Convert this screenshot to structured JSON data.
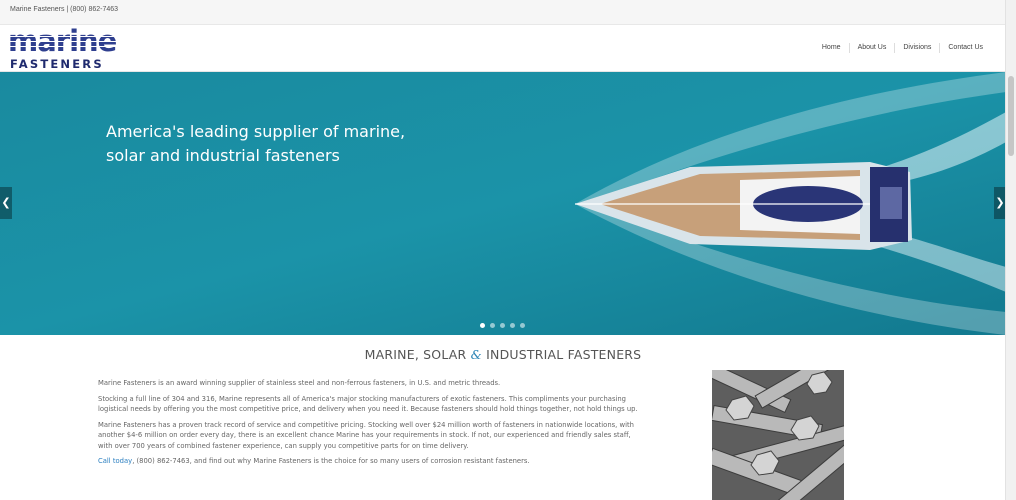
{
  "topbar": {
    "text": "Marine Fasteners | (800) 862-7463"
  },
  "logo": {
    "top": "marine",
    "bottom": "FASTENERS"
  },
  "nav": {
    "items": [
      "Home",
      "About Us",
      "Divisions",
      "Contact Us"
    ]
  },
  "hero": {
    "headline": "America's leading supplier of marine, solar and industrial fasteners",
    "slides": {
      "count": 5,
      "active": 1
    }
  },
  "section": {
    "title_part1": "MARINE, SOLAR",
    "title_amp": "&",
    "title_part2": "INDUSTRIAL FASTENERS"
  },
  "content": {
    "p1": "Marine Fasteners is an award winning supplier of stainless steel and non-ferrous fasteners, in U.S. and metric threads.",
    "p2": "Stocking a full line of 304 and 316, Marine represents all of America's major stocking manufacturers of exotic fasteners. This compliments your purchasing logistical needs by offering you the most competitive price, and delivery when you need it. Because fasteners should hold things together, not hold things up.",
    "p3": "Marine Fasteners has a proven track record of service and competitive pricing. Stocking well over $24 million worth of fasteners in nationwide locations, with another $4-6 million on order every day, there is an excellent chance Marine has your requirements in stock. If not, our experienced and friendly sales staff, with over 700 years of combined fastener experience, can supply you competitive parts for on time delivery.",
    "call_link": "Call today",
    "p4_rest": ", (800) 862-7463, and find out why Marine Fasteners is the choice for so many users of corrosion resistant fasteners."
  },
  "icons": {
    "prev": "chevron-left-icon",
    "next": "chevron-right-icon"
  },
  "colors": {
    "brand": "#2f3f8f",
    "link": "#2b7fc0",
    "sea": "#1f8fa3"
  }
}
